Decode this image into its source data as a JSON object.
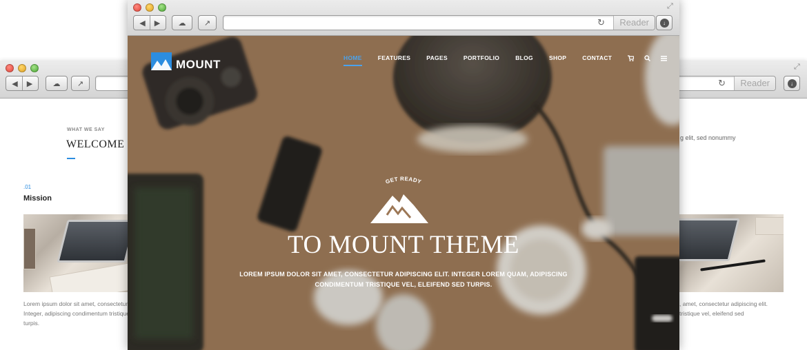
{
  "back_window": {
    "toolbar": {
      "reader_label": "Reader"
    },
    "section": {
      "eyebrow": "WHAT WE SAY",
      "title": "WELCOME",
      "right_snippet": "g elit, sed nonummy"
    },
    "mission": {
      "number": ".01",
      "title": "Mission",
      "text_left_1": "Lorem ipsum dolor sit amet, consectetur",
      "text_left_2": "Integer, adipiscing condimentum tristique",
      "text_left_3": "turpis.",
      "text_right_1": ", amet, consectetur adipiscing elit.",
      "text_right_2": "tristique vel, eleifend sed"
    }
  },
  "front_window": {
    "toolbar": {
      "reader_label": "Reader"
    },
    "brand": {
      "name": "MOUNT",
      "accent": "#2b8de0"
    },
    "nav": {
      "items": [
        {
          "label": "HOME",
          "active": true
        },
        {
          "label": "FEATURES",
          "active": false
        },
        {
          "label": "PAGES",
          "active": false
        },
        {
          "label": "PORTFOLIO",
          "active": false
        },
        {
          "label": "BLOG",
          "active": false
        },
        {
          "label": "SHOP",
          "active": false
        },
        {
          "label": "CONTACT",
          "active": false
        }
      ],
      "icons": [
        "cart-icon",
        "search-icon",
        "menu-icon"
      ]
    },
    "hero": {
      "eyebrow": "GET READY",
      "title": "TO MOUNT THEME",
      "subtitle_line1": "LOREM IPSUM DOLOR SIT AMET, CONSECTETUR ADIPISCING ELIT. INTEGER LOREM QUAM, ADIPISCING",
      "subtitle_line2": "CONDIMENTUM TRISTIQUE VEL, ELEIFEND SED TURPIS."
    }
  }
}
